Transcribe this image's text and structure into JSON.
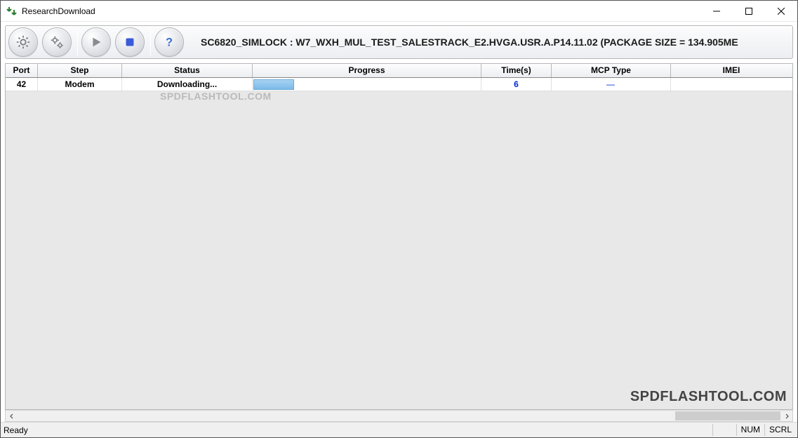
{
  "window": {
    "title": "ResearchDownload"
  },
  "toolbar": {
    "package_line": "SC6820_SIMLOCK : W7_WXH_MUL_TEST_SALESTRACK_E2.HVGA.USR.A.P14.11.02 (PACKAGE SIZE = 134.905ME"
  },
  "columns": {
    "port": "Port",
    "step": "Step",
    "status": "Status",
    "progress": "Progress",
    "time": "Time(s)",
    "mcp": "MCP Type",
    "imei": "IMEI"
  },
  "rows": [
    {
      "port": "42",
      "step": "Modem",
      "status": "Downloading...",
      "time": "6",
      "mcp": "—",
      "imei": "",
      "progress_pct": 18
    }
  ],
  "statusbar": {
    "ready": "Ready",
    "num": "NUM",
    "scrl": "SCRL"
  },
  "watermark": "SPDFLASHTOOL.COM"
}
